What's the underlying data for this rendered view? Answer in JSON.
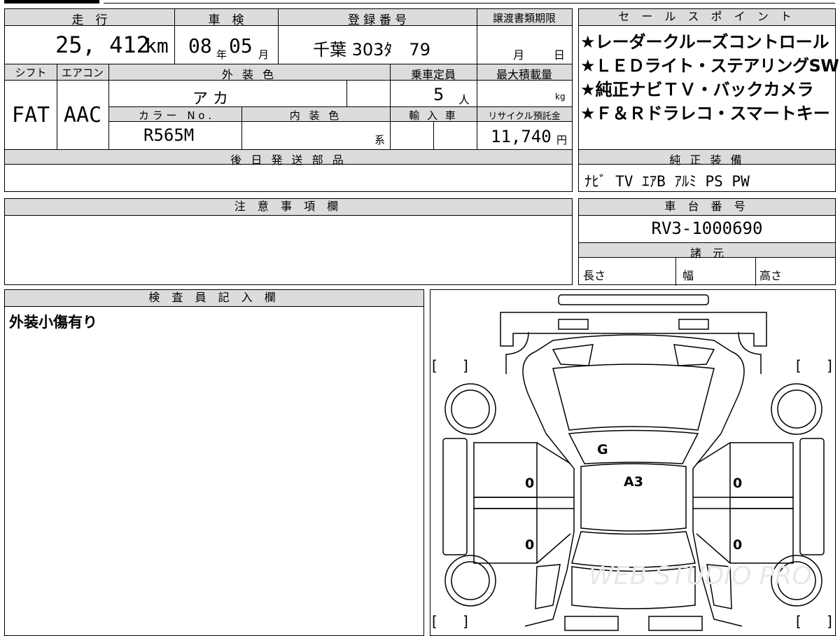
{
  "top": {
    "mileage_header": "走　行",
    "mileage": "25, 412",
    "mileage_unit": "km",
    "shaken_header": "車　検",
    "shaken_year": "08",
    "shaken_year_unit": "年",
    "shaken_month": "05",
    "shaken_month_unit": "月",
    "reg_header": "登 録 番 号",
    "reg_number": "千葉 303ﾀ　79",
    "transfer_header": "譲渡書類期限",
    "transfer_month": "月",
    "transfer_day": "日"
  },
  "middle": {
    "shift_header": "シフト",
    "shift": "FAT",
    "ac_header": "エアコン",
    "ac": "AAC",
    "ext_color_header": "外 装 色",
    "ext_color": "ア カ",
    "capacity_header": "乗車定員",
    "capacity": "5",
    "capacity_unit": "人",
    "max_load_header": "最大積載量",
    "max_load_unit": "kg",
    "color_no_header": "カ ラ ー　N o .",
    "color_no": "R565M",
    "int_color_header": "内 装 色",
    "int_color_unit": "系",
    "import_header": "輸 入 車",
    "recycle_header": "リサイクル預託金",
    "recycle_amount": "11,740",
    "recycle_unit": "円"
  },
  "later_parts_header": "後 日 発 送 部 品",
  "sales_points": {
    "header": "セ ー ル ス ポ イ ン ト",
    "items": [
      "★レーダークルーズコントロール",
      "★ＬＥＤライト・ステアリングSW",
      "★純正ナビＴＶ・バックカメラ",
      "★Ｆ＆Ｒドラレコ・スマートキー"
    ]
  },
  "genuine_equipment": {
    "header": "純 正 装 備",
    "value": "ﾅﾋﾞ TV ｴｱB ｱﾙﾐ PS PW"
  },
  "notes": {
    "header": "注 意 事 項 欄"
  },
  "chassis": {
    "header": "車 台 番 号",
    "value": "RV3-1000690"
  },
  "specs": {
    "header": "諸　元",
    "length": "長さ",
    "width": "幅",
    "height": "高さ"
  },
  "inspector": {
    "header": "検 査 員 記 入 欄",
    "comment": "外装小傷有り"
  },
  "diagram": {
    "marks": {
      "windshield": "G",
      "roof": "A3",
      "left_front_door": "0",
      "left_rear_door": "0",
      "right_front_door": "0",
      "right_rear_door": "0"
    },
    "bracket_open": "[",
    "bracket_close": "]",
    "watermark": "WEB STUDIO PRO"
  }
}
